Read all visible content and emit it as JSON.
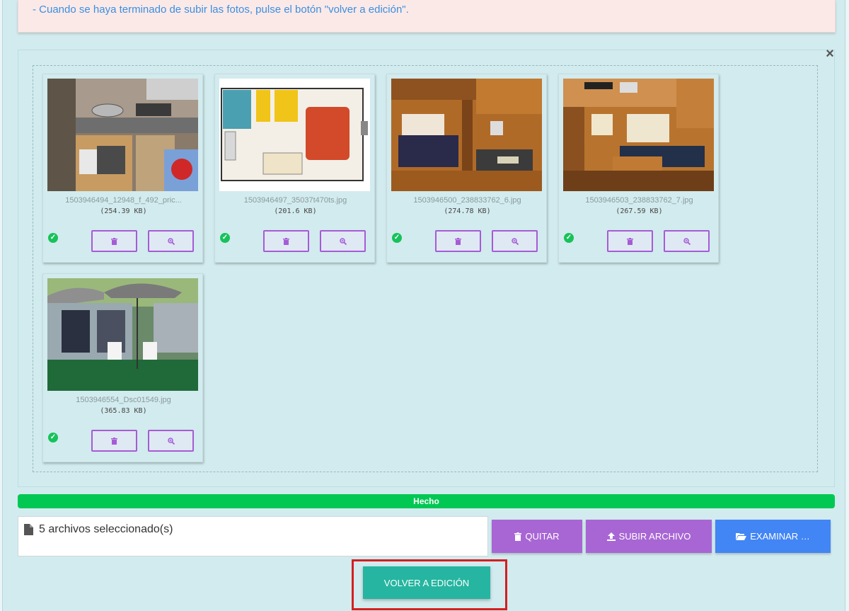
{
  "notice": {
    "text": "- Cuando se haya terminado de subir las fotos, pulse el botón \"volver a edición\"."
  },
  "files": [
    {
      "name": "1503946494_12948_f_492_pric...",
      "size": "(254.39 KB)",
      "thumb": "kitchen"
    },
    {
      "name": "1503946497_35037t470ts.jpg",
      "size": "(201.6 KB)",
      "thumb": "floorplan"
    },
    {
      "name": "1503946500_238833762_6.jpg",
      "size": "(274.78 KB)",
      "thumb": "interior-bed"
    },
    {
      "name": "1503946503_238833762_7.jpg",
      "size": "(267.59 KB)",
      "thumb": "interior-dining"
    },
    {
      "name": "1503946554_Dsc01549.jpg",
      "size": "(365.83 KB)",
      "thumb": "awning"
    }
  ],
  "progress": {
    "label": "Hecho",
    "percent": 100,
    "color": "#00c853"
  },
  "file_input": {
    "text": "5 archivos seleccionado(s)"
  },
  "buttons": {
    "quitar": "QUITAR",
    "subir": "SUBIR ARCHIVO",
    "examinar": "EXAMINAR …",
    "volver": "VOLVER A EDICIÓN"
  },
  "colors": {
    "purple": "#a866d4",
    "blue": "#4285f4",
    "teal": "#26b5a0",
    "highlight": "#d32020"
  },
  "icons": {
    "close": "close-icon",
    "trash": "trash-icon",
    "zoom": "zoom-in-icon",
    "check": "check-circle-icon",
    "file": "file-icon",
    "upload": "upload-icon",
    "folder": "folder-open-icon"
  }
}
